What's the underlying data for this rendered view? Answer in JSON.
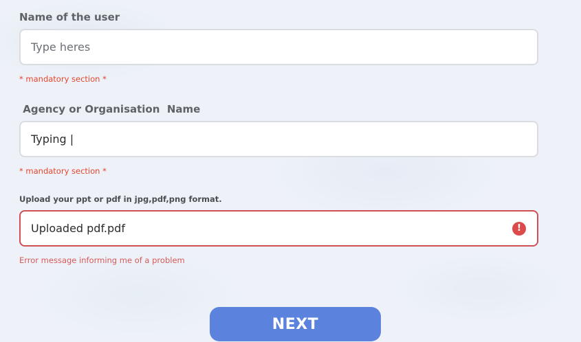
{
  "form": {
    "user_name": {
      "label": "Name of the user",
      "placeholder": "Type heres",
      "value": "",
      "hint": "* mandatory section *"
    },
    "agency_name": {
      "label": " Agency or Organisation  Name",
      "placeholder": "",
      "value": "Typing |",
      "hint": "* mandatory section *"
    },
    "upload": {
      "label": "Upload your ppt or pdf in jpg,pdf,png format.",
      "value": "Uploaded pdf.pdf",
      "error_icon_glyph": "!",
      "error_message": "Error message informing me of a problem"
    },
    "next_label": "NEXT"
  },
  "colors": {
    "accent": "#5b82dc",
    "error": "#dc4b4b",
    "mandatory_hint": "#e0452c",
    "field_border": "#d9dce1"
  },
  "icons": {
    "error": "exclamation-circle-icon"
  }
}
